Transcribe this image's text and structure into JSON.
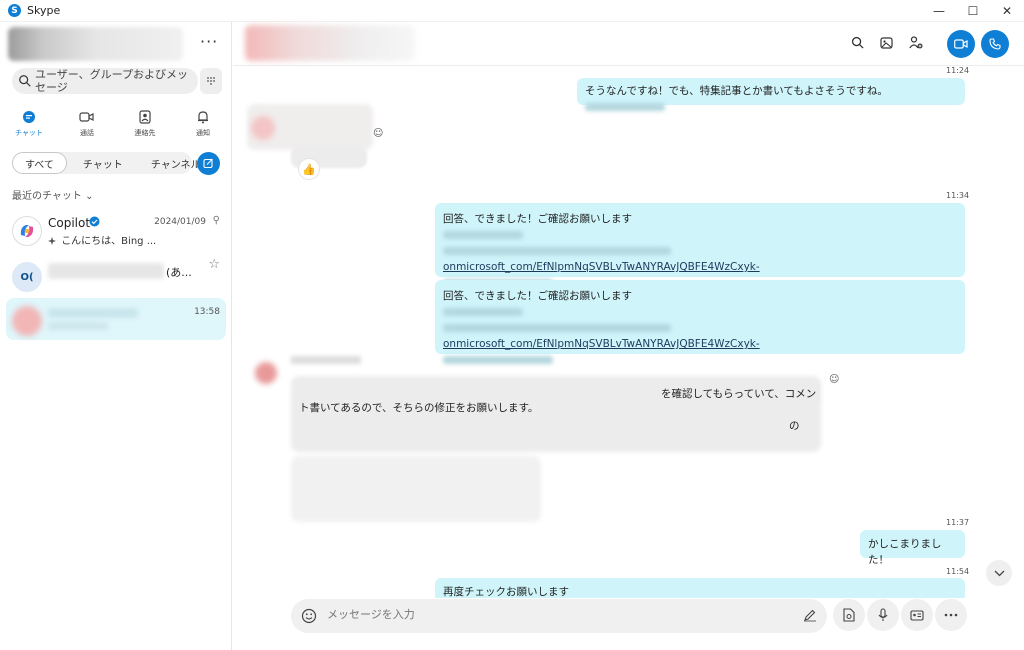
{
  "app": {
    "title": "Skype"
  },
  "window": {
    "minimize": "—",
    "maximize": "☐",
    "close": "✕"
  },
  "sidebar": {
    "more": "···",
    "search": {
      "placeholder": "ユーザー、グループおよびメッセージ"
    },
    "nav": [
      {
        "label": "チャット",
        "icon": "chat-icon",
        "active": true
      },
      {
        "label": "通話",
        "icon": "video-call-icon"
      },
      {
        "label": "連絡先",
        "icon": "contacts-icon"
      },
      {
        "label": "通知",
        "icon": "bell-icon"
      }
    ],
    "filters": [
      "すべて",
      "チャット",
      "チャンネル"
    ],
    "recent_header": "最近のチャット ⌄",
    "chats": [
      {
        "name": "Copilot",
        "preview": "こんにちは、Bing ...",
        "time": "2024/01/09"
      },
      {
        "initials": "O(",
        "name_suffix": "(あ..."
      },
      {
        "time": "13:58"
      }
    ]
  },
  "messages": {
    "t1": "11:24",
    "m1": "そうなんですね！でも、特集記事とか書いてもよさそうですね。",
    "t2": "11:34",
    "m2_line1": "回答、できました！ご確認お願いします",
    "m2_link": "onmicrosoft_com/EfNlpmNqSVBLvTwANYRAvJQBFE4WzCxyk-",
    "m3_line1": "回答、できました！ご確認お願いします",
    "m3_link": "onmicrosoft_com/EfNlpmNqSVBLvTwANYRAvJQBFE4WzCxyk-",
    "in_tail": "を確認してもらっていて、コメン",
    "in_line2": "ト書いてあるので、そちらの修正をお願いします。",
    "in_frag": "の",
    "t3": "11:37",
    "m4": "かしこまりました！",
    "t4": "11:54",
    "m5": "再度チェックお願いします"
  },
  "composer": {
    "placeholder": "メッセージを入力"
  },
  "colors": {
    "accent": "#0f7fd6",
    "bubble_out": "#cff5fb",
    "selected_chat": "#dff6fb"
  }
}
